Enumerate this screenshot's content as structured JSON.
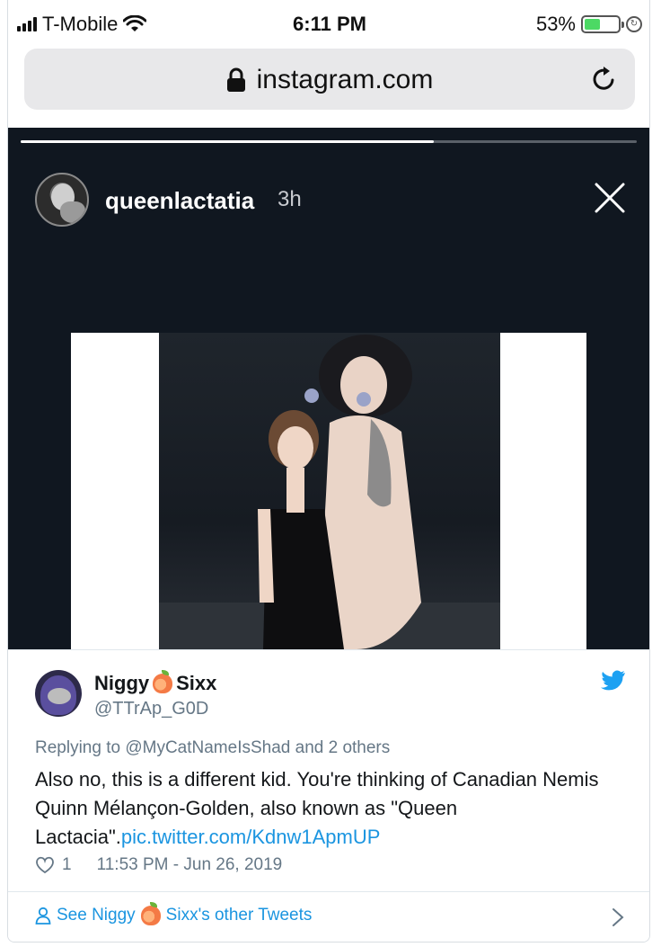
{
  "status_bar": {
    "carrier": "T-Mobile",
    "time": "6:11 PM",
    "battery_percent": "53%",
    "battery_level": 0.53,
    "battery_color": "#4cd964"
  },
  "browser": {
    "url": "instagram.com",
    "lock_icon": "lock-icon",
    "reload_icon": "reload-icon"
  },
  "story": {
    "progress": 0.67,
    "username": "queenlactatia",
    "age": "3h",
    "close_icon": "close-icon",
    "background_color": "#101720"
  },
  "tweet": {
    "name_part1": "Niggy",
    "name_part2": "Sixx",
    "handle": "@TTrAp_G0D",
    "replying_to": "Replying to @MyCatNameIsShad and 2 others",
    "text": "Also no, this is a different kid. You're thinking of Canadian Nemis Quinn Mélançon-Golden, also known as \"Queen Lactacia\".",
    "link": "pic.twitter.com/Kdnw1ApmUP",
    "like_count": "1",
    "timestamp": "11:53 PM - Jun 26, 2019",
    "see_more_part1": "See Niggy",
    "see_more_part2": "Sixx's other Tweets",
    "link_color": "#1b95e0",
    "twitter_icon": "twitter-bird-icon"
  }
}
